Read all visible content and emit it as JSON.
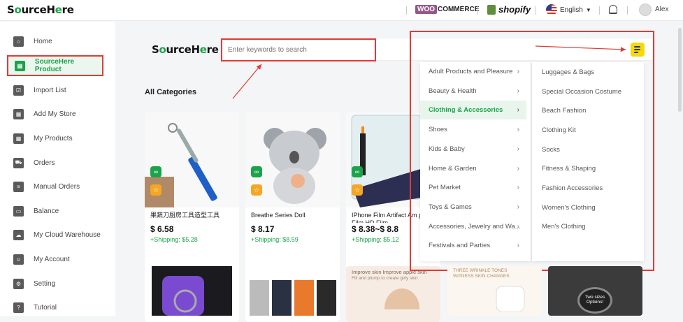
{
  "topbar": {
    "logo": "SourceHere",
    "woo_logo": "COMMERCE",
    "woo_prefix": "WOO",
    "shopify_logo": "shopify",
    "language": "English",
    "user_name": "Alex"
  },
  "sidebar": {
    "items": [
      {
        "label": "Home",
        "icon": "home-icon"
      },
      {
        "label": "SourceHere Product",
        "icon": "store-icon"
      },
      {
        "label": "Import List",
        "icon": "clipboard-icon"
      },
      {
        "label": "Add My Store",
        "icon": "shop-icon"
      },
      {
        "label": "My Products",
        "icon": "grid-icon"
      },
      {
        "label": "Orders",
        "icon": "cart-icon"
      },
      {
        "label": "Manual Orders",
        "icon": "document-icon"
      },
      {
        "label": "Balance",
        "icon": "wallet-icon"
      },
      {
        "label": "My Cloud Warehouse",
        "icon": "cloud-icon"
      },
      {
        "label": "My Account",
        "icon": "user-icon"
      },
      {
        "label": "Setting",
        "icon": "gear-icon"
      },
      {
        "label": "Tutorial",
        "icon": "help-icon"
      }
    ]
  },
  "main": {
    "logo": "SourceHere",
    "search_placeholder": "Enter keywords to search",
    "section_title": "All Categories"
  },
  "products": [
    {
      "title": "果蔬刀厨房工具造型工具",
      "price": "$ 6.58",
      "shipping": "+Shipping: $5.28"
    },
    {
      "title": "Breathe Series Doll",
      "price": "$ 8.17",
      "shipping": "+Shipping: $8.59"
    },
    {
      "title": "IPhone Film Artifact Am peep Film HD Film",
      "price": "$ 8.38~$ 8.8",
      "shipping": "+Shipping: $5.12"
    }
  ],
  "categories": [
    "Adult Products and Pleasure",
    "Beauty & Health",
    "Clothing & Accessories",
    "Shoes",
    "Kids & Baby",
    "Home & Garden",
    "Pet Market",
    "Toys & Games",
    "Accessories, Jewelry and Wa...",
    "Festivals and Parties"
  ],
  "selected_category": "Clothing & Accessories",
  "subcategories": [
    "Luggages & Bags",
    "Special Occasion Costume",
    "Beach Fashion",
    "Clothing Kit",
    "Socks",
    "Fitness & Shaping",
    "Fashion Accessories",
    "Women's Clothing",
    "Men's Clothing"
  ],
  "promo_texts": {
    "skin": "Improve skin Improve apple skin",
    "skin_sub": "Fill and plump to create girly skin",
    "wrinkle": "THREE WRINKLE TONES",
    "wrinkle2": "WITNESS SKIN CHANGES",
    "sizes": "Two sizes Options!"
  },
  "colors": {
    "accent": "#1aa34a",
    "highlight": "#e53935",
    "menu_button": "#f5d90a"
  }
}
